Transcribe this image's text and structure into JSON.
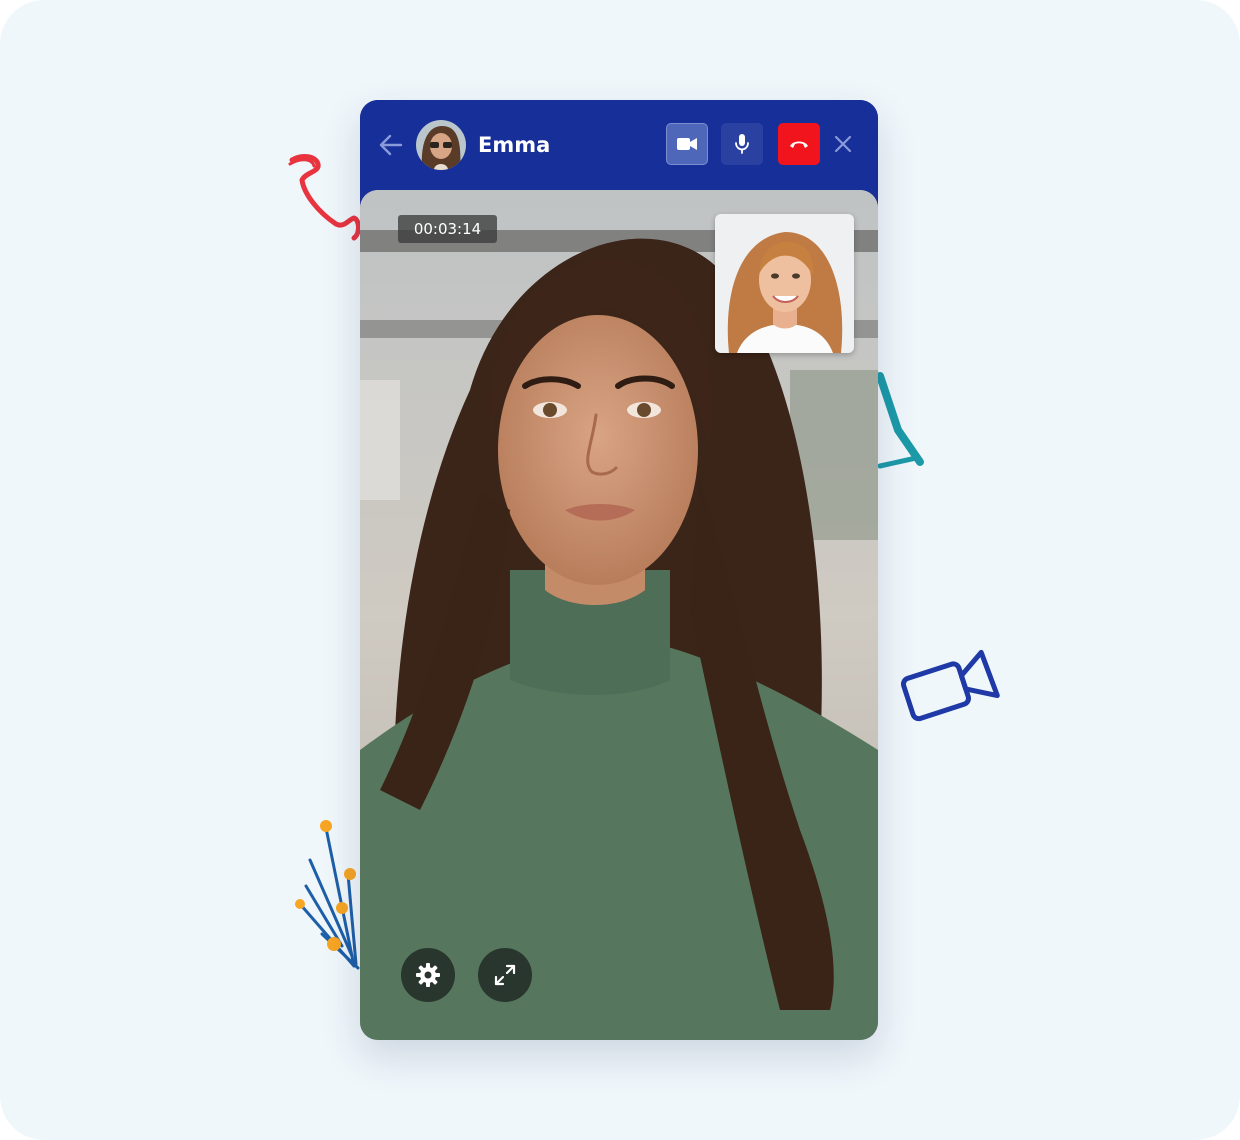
{
  "caller": {
    "name": "Emma",
    "avatar_icon": "person-avatar"
  },
  "call": {
    "duration": "00:03:14"
  },
  "header_controls": {
    "back_icon": "arrow-left-icon",
    "video_icon": "video-camera-icon",
    "mic_icon": "microphone-icon",
    "end_call_icon": "phone-hangup-icon",
    "close_icon": "close-icon"
  },
  "video_controls": {
    "settings_icon": "gear-icon",
    "expand_icon": "expand-icon"
  },
  "colors": {
    "header": "#172f98",
    "end_call": "#f2141c",
    "background": "#f0f7fb"
  }
}
